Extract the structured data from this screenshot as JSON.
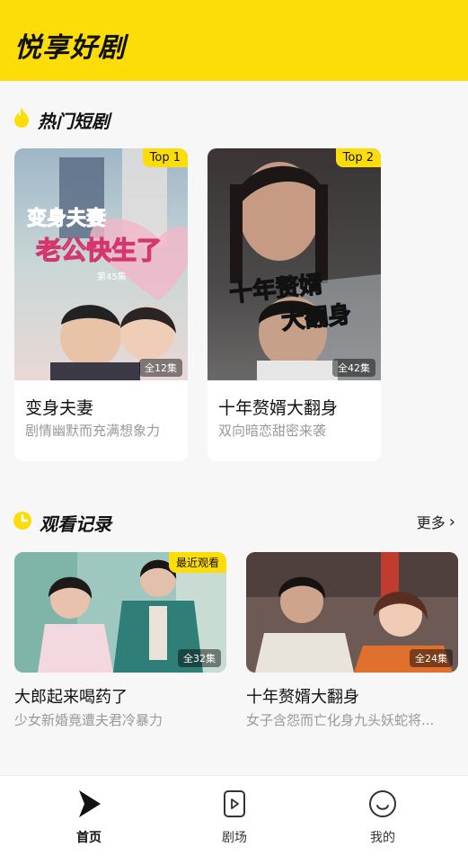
{
  "app": {
    "title": "悦享好剧"
  },
  "hot": {
    "title": "热门短剧",
    "items": [
      {
        "rank": "Top 1",
        "episodes": "全12集",
        "title": "变身夫妻",
        "desc": "剧情幽默而充满想象力",
        "poster_text_1": "变身夫妻",
        "poster_text_2": "老公快生了",
        "poster_sub": "第45集"
      },
      {
        "rank": "Top 2",
        "episodes": "全42集",
        "title": "十年赘婿大翻身",
        "desc": "双向暗恋甜密来袭",
        "poster_text_1": "十年赘婿",
        "poster_text_2": "大翻身"
      }
    ]
  },
  "history": {
    "title": "观看记录",
    "more": "更多",
    "items": [
      {
        "badge": "最近观看",
        "episodes": "全32集",
        "title": "大郎起来喝药了",
        "desc": "少女新婚竟遭夫君冷暴力"
      },
      {
        "episodes": "全24集",
        "title": "十年赘婿大翻身",
        "desc": "女子含怨而亡化身九头妖蛇将..."
      }
    ]
  },
  "tabs": [
    {
      "label": "首页",
      "icon": "play-logo-icon",
      "active": true
    },
    {
      "label": "剧场",
      "icon": "theater-icon",
      "active": false
    },
    {
      "label": "我的",
      "icon": "smile-icon",
      "active": false
    }
  ],
  "colors": {
    "brand": "#fddd08",
    "text": "#111111",
    "muted": "#999999"
  }
}
